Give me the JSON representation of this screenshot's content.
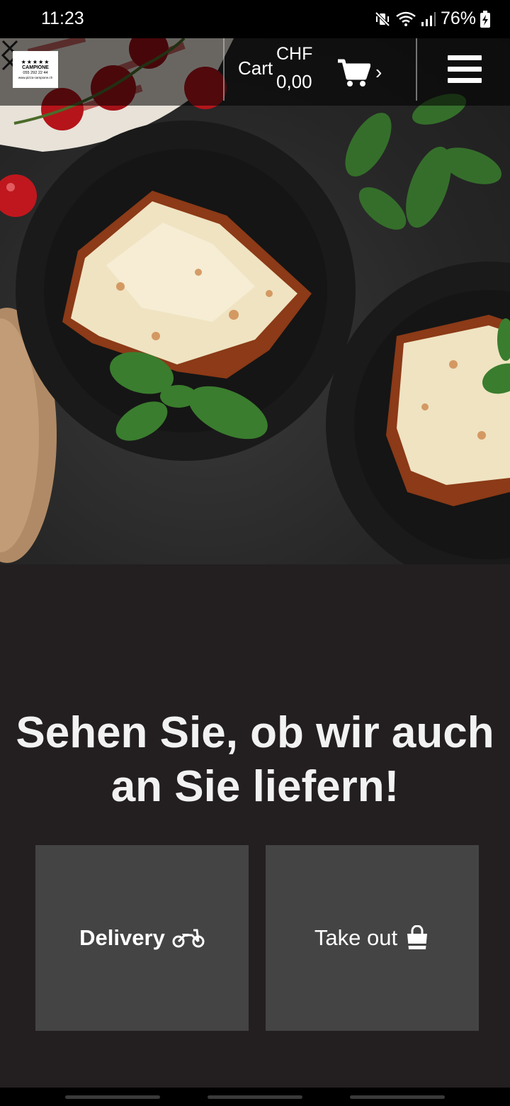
{
  "status_bar": {
    "time": "11:23",
    "battery": "76%",
    "icons": [
      "mute-vibrate-icon",
      "wifi-icon",
      "signal-icon",
      "battery-charging-icon"
    ]
  },
  "header": {
    "logo": {
      "stars": "★★★★★",
      "name": "CAMPIONE",
      "phone": "055 292 22 44",
      "web": "www.pizza-campione.ch"
    },
    "cart": {
      "label": "Cart",
      "currency": "CHF",
      "amount": "0,00",
      "chevron": "›"
    }
  },
  "hero": {
    "prev_arrow": "‹",
    "next_arrow": "›"
  },
  "main": {
    "headline": "Sehen Sie, ob wir auch an Sie liefern!",
    "options": [
      {
        "label": "Delivery",
        "icon": "motorcycle-icon"
      },
      {
        "label": "Take out",
        "icon": "shopping-bag-icon"
      }
    ]
  },
  "colors": {
    "lower_bg": "#231f20",
    "button_bg": "#444444",
    "text": "#ffffff"
  }
}
